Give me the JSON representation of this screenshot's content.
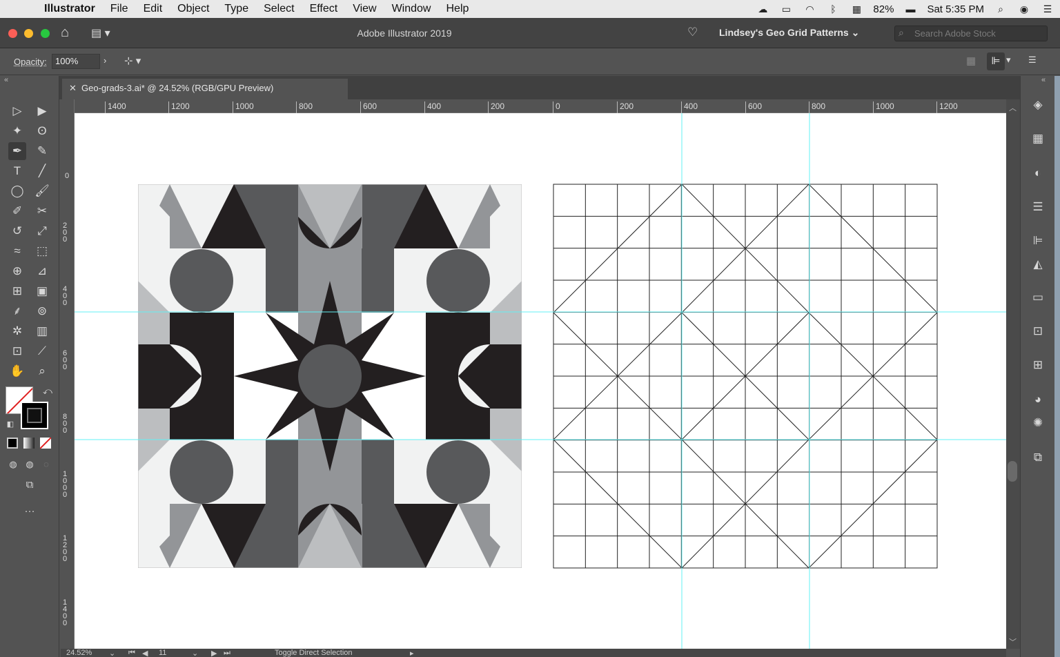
{
  "menubar": {
    "app": "Illustrator",
    "items": [
      "File",
      "Edit",
      "Object",
      "Type",
      "Select",
      "Effect",
      "View",
      "Window",
      "Help"
    ],
    "battery": "82%",
    "clock": "Sat 5:35 PM"
  },
  "appbar": {
    "title": "Adobe Illustrator 2019",
    "workspace": "Lindsey's Geo Grid Patterns",
    "search_placeholder": "Search Adobe Stock"
  },
  "control": {
    "opacity_label": "Opacity:",
    "opacity_value": "100%"
  },
  "document": {
    "tab_title": "Geo-grads-3.ai* @ 24.52% (RGB/GPU Preview)"
  },
  "rulers": {
    "horizontal": [
      "1400",
      "1200",
      "1000",
      "800",
      "600",
      "400",
      "200",
      "0",
      "200",
      "400",
      "600",
      "800",
      "1000",
      "1200"
    ],
    "vertical": [
      "0",
      "200",
      "400",
      "600",
      "800",
      "1000",
      "1200",
      "1400"
    ]
  },
  "status": {
    "zoom": "24.52%",
    "artboard": "11",
    "tool_hint": "Toggle Direct Selection"
  },
  "colors": {
    "guide": "#62f0f4",
    "pattern_black": "#231f20",
    "pattern_dark": "#58595b",
    "pattern_mid": "#939598",
    "pattern_light": "#bcbec0",
    "pattern_bg": "#f1f2f2"
  }
}
